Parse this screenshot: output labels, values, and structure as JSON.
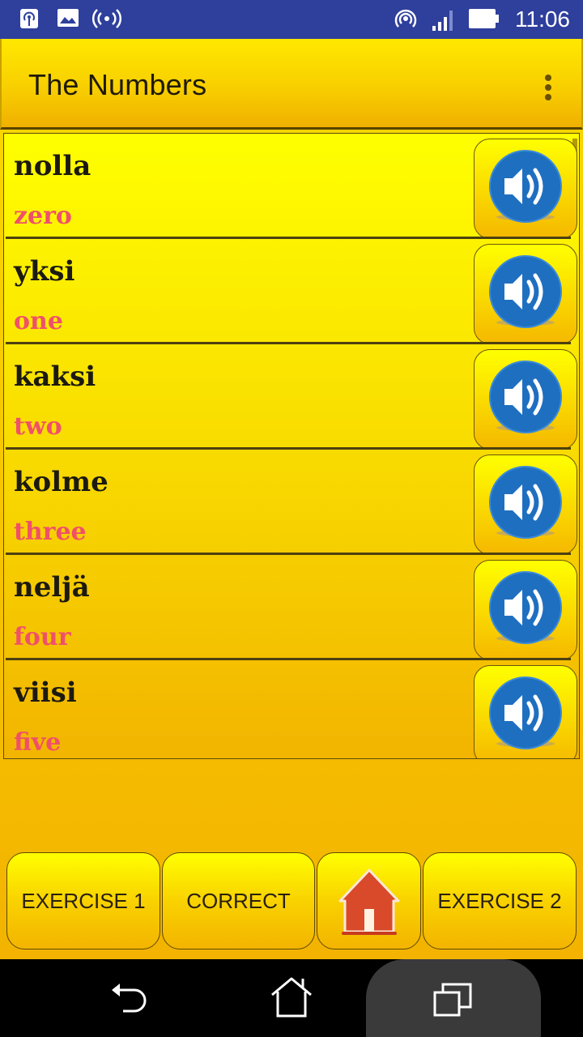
{
  "status_bar": {
    "left_icons": [
      "hotspot-icon",
      "image-icon",
      "broadcast-icon"
    ],
    "right_icons": [
      "hotspot-icon",
      "signal-icon",
      "battery-icon"
    ],
    "time": "11:06"
  },
  "app_bar": {
    "title": "The Numbers",
    "menu_icon": "overflow-menu-icon"
  },
  "colors": {
    "status_bar": "#2e3f9c",
    "word": "#1c1a10",
    "translation": "#f0506a",
    "speaker": "#1f6fc0",
    "home": "#d84a2a"
  },
  "list": {
    "items": [
      {
        "word": "nolla",
        "translation": "zero"
      },
      {
        "word": "yksi",
        "translation": "one"
      },
      {
        "word": "kaksi",
        "translation": "two"
      },
      {
        "word": "kolme",
        "translation": "three"
      },
      {
        "word": "neljä",
        "translation": "four"
      },
      {
        "word": "viisi",
        "translation": "five"
      }
    ],
    "speaker_icon": "speaker-icon"
  },
  "bottom_bar": {
    "exercise1_label": "EXERCISE 1",
    "correct_label": "CORRECT",
    "home_icon": "home-icon",
    "exercise2_label": "EXERCISE 2"
  },
  "nav_bar": {
    "icons": [
      "back-icon",
      "home-icon",
      "recents-icon"
    ]
  }
}
